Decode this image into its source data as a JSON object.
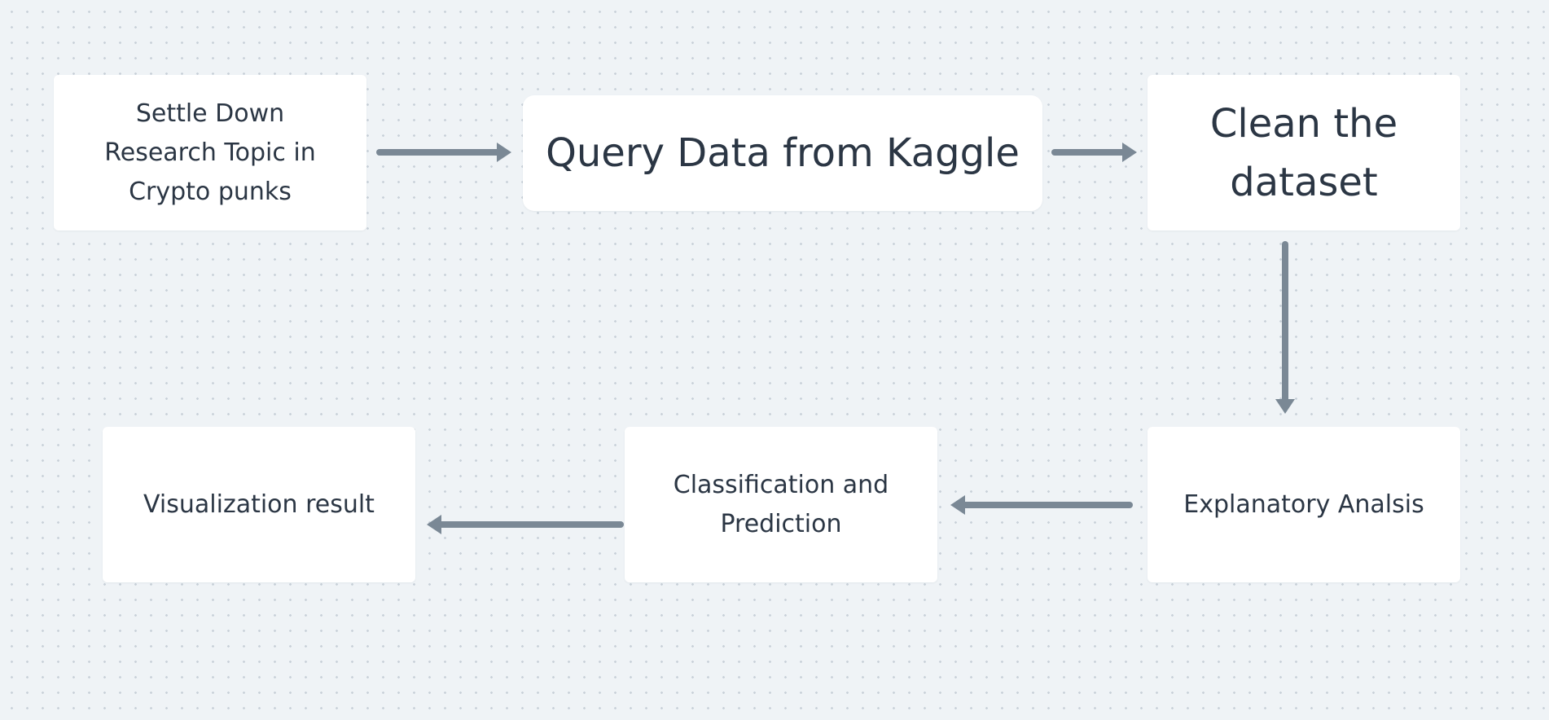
{
  "diagram": {
    "nodes": [
      {
        "id": "settle",
        "label": "Settle Down Research Topic in Crypto punks"
      },
      {
        "id": "query",
        "label": "Query Data from Kaggle"
      },
      {
        "id": "clean",
        "label": "Clean the dataset"
      },
      {
        "id": "explore",
        "label": "Explanatory Analsis"
      },
      {
        "id": "classify",
        "label": "Classification and Prediction"
      },
      {
        "id": "visualize",
        "label": "Visualization result"
      }
    ],
    "edges": [
      {
        "from": "settle",
        "to": "query"
      },
      {
        "from": "query",
        "to": "clean"
      },
      {
        "from": "clean",
        "to": "explore"
      },
      {
        "from": "explore",
        "to": "classify"
      },
      {
        "from": "classify",
        "to": "visualize"
      }
    ],
    "colors": {
      "background": "#eff3f6",
      "node_fill": "#ffffff",
      "text": "#2b3644",
      "edge": "#7a8895"
    }
  }
}
